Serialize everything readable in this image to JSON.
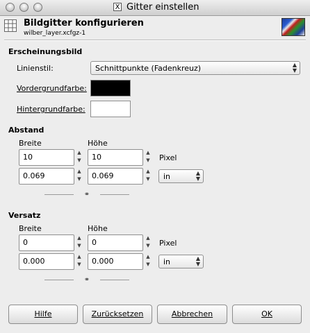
{
  "window": {
    "title": "Gitter einstellen",
    "title_icon": "X"
  },
  "header": {
    "title": "Bildgitter konfigurieren",
    "subtitle": "wilber_layer.xcfgz-1"
  },
  "appearance": {
    "section": "Erscheinungsbild",
    "line_style_label": "Linienstil:",
    "line_style_value": "Schnittpunkte (Fadenkreuz)",
    "fg_label": "Vordergrundfarbe:",
    "fg_color": "#000000",
    "bg_label": "Hintergrundfarbe:",
    "bg_color": "#ffffff"
  },
  "spacing": {
    "section": "Abstand",
    "width_label": "Breite",
    "height_label": "Höhe",
    "width_px": "10",
    "height_px": "10",
    "px_unit": "Pixel",
    "width_in": "0.069",
    "height_in": "0.069",
    "unit": "in"
  },
  "offset": {
    "section": "Versatz",
    "width_label": "Breite",
    "height_label": "Höhe",
    "width_px": "0",
    "height_px": "0",
    "px_unit": "Pixel",
    "width_in": "0.000",
    "height_in": "0.000",
    "unit": "in"
  },
  "buttons": {
    "help": "Hilfe",
    "reset": "Zurücksetzen",
    "cancel": "Abbrechen",
    "ok": "OK"
  },
  "icons": {
    "grid": "grid-icon",
    "chain": "chain-link-icon",
    "spin": "spin-arrows-icon"
  }
}
